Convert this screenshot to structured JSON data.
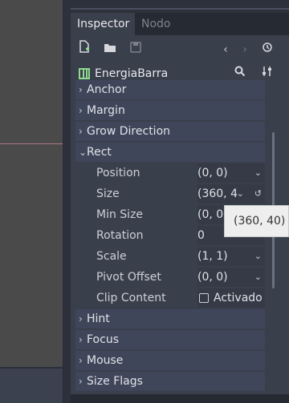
{
  "tabs": [
    {
      "label": "Inspector",
      "active": true
    },
    {
      "label": "Nodo",
      "active": false
    }
  ],
  "toolbar": {
    "icons": [
      "new-script-icon",
      "open-folder-icon",
      "save-icon",
      "history-back-icon",
      "history-forward-icon",
      "object-history-icon"
    ]
  },
  "object": {
    "name": "EnergiaBarra"
  },
  "sections": [
    {
      "label": "Anchor",
      "expanded": false
    },
    {
      "label": "Margin",
      "expanded": false
    },
    {
      "label": "Grow Direction",
      "expanded": false
    },
    {
      "label": "Rect",
      "expanded": true
    }
  ],
  "rect_props": [
    {
      "label": "Position",
      "value": "(0, 0)"
    },
    {
      "label": "Size",
      "value": "(360, 4"
    },
    {
      "label": "Min Size",
      "value": "(0, 0)"
    },
    {
      "label": "Rotation",
      "value": "0"
    },
    {
      "label": "Scale",
      "value": "(1, 1)"
    },
    {
      "label": "Pivot Offset",
      "value": "(0, 0)"
    },
    {
      "label": "Clip Content",
      "value": "Activado"
    }
  ],
  "sections_after": [
    {
      "label": "Hint"
    },
    {
      "label": "Focus"
    },
    {
      "label": "Mouse"
    },
    {
      "label": "Size Flags"
    }
  ],
  "tooltip": {
    "text": "(360, 40)"
  },
  "colors": {
    "accent": "#8eda8e",
    "panel": "#3a3f4c"
  }
}
